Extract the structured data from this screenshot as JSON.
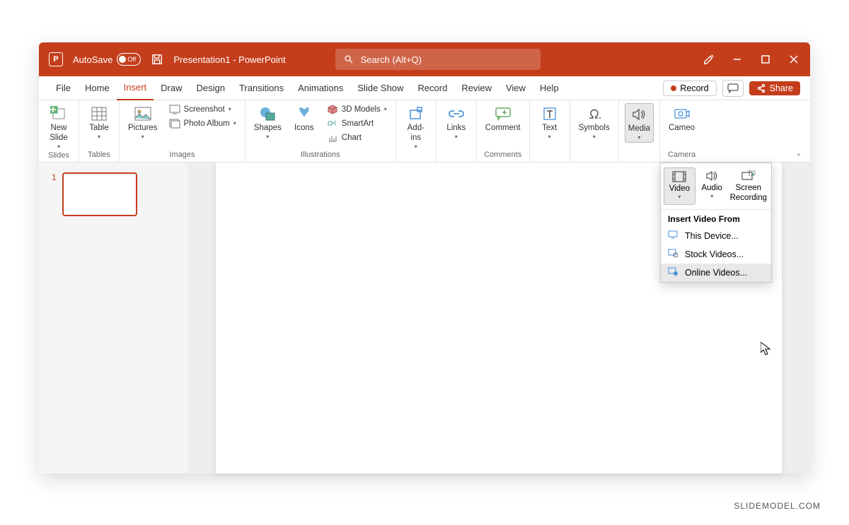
{
  "titlebar": {
    "autosave_label": "AutoSave",
    "autosave_state": "Off",
    "doc_title": "Presentation1 - PowerPoint",
    "search_placeholder": "Search (Alt+Q)"
  },
  "tabs": {
    "file": "File",
    "home": "Home",
    "insert": "Insert",
    "draw": "Draw",
    "design": "Design",
    "transitions": "Transitions",
    "animations": "Animations",
    "slideshow": "Slide Show",
    "record": "Record",
    "review": "Review",
    "view": "View",
    "help": "Help"
  },
  "tab_right": {
    "record": "Record",
    "share": "Share"
  },
  "ribbon": {
    "slides": {
      "label": "Slides",
      "new_slide": "New\nSlide"
    },
    "tables": {
      "label": "Tables",
      "table": "Table"
    },
    "images": {
      "label": "Images",
      "pictures": "Pictures",
      "screenshot": "Screenshot",
      "photo_album": "Photo Album"
    },
    "illustrations": {
      "label": "Illustrations",
      "shapes": "Shapes",
      "icons": "Icons",
      "models": "3D Models",
      "smartart": "SmartArt",
      "chart": "Chart"
    },
    "addins": {
      "label": "",
      "addins": "Add-\nins"
    },
    "links": {
      "label": "",
      "links": "Links"
    },
    "comments": {
      "label": "Comments",
      "comment": "Comment"
    },
    "text": {
      "label": "",
      "text": "Text"
    },
    "symbols": {
      "label": "",
      "symbols": "Symbols"
    },
    "media": {
      "label": "",
      "media": "Media"
    },
    "camera": {
      "label": "Camera",
      "cameo": "Cameo"
    }
  },
  "thumbs": {
    "num": "1"
  },
  "media_dropdown": {
    "video": "Video",
    "audio": "Audio",
    "screen_rec": "Screen\nRecording",
    "header": "Insert Video From",
    "this_device": "This Device...",
    "stock": "Stock Videos...",
    "online": "Online Videos..."
  },
  "watermark": "SLIDEMODEL.COM"
}
